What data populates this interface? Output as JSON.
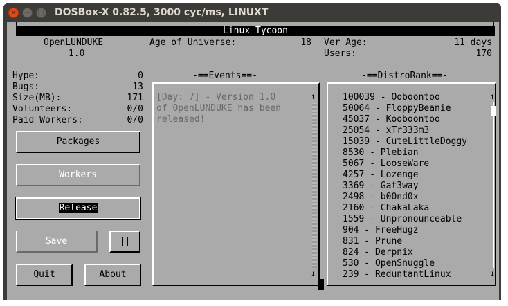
{
  "window": {
    "title": "DOSBox-X 0.82.5, 3000 cyc/ms, LINUXT"
  },
  "game": {
    "title": "Linux Tycoon",
    "distro_name": "OpenLUNDUKE",
    "distro_version": "1.0",
    "age_label": "Age of Universe:",
    "age_value": "18",
    "ver_age_label": "Ver Age:",
    "ver_age_value": "11 days",
    "users_label": "Users:",
    "users_value": "170"
  },
  "stats": [
    {
      "label": "Hype:",
      "value": "0"
    },
    {
      "label": "Bugs:",
      "value": "13"
    },
    {
      "label": "Size(MB):",
      "value": "171"
    },
    {
      "label": "Volunteers:",
      "value": "0/0"
    },
    {
      "label": "Paid Workers:",
      "value": "0/0"
    }
  ],
  "buttons": {
    "packages": "Packages",
    "workers": "Workers",
    "release": "Release",
    "save": "Save",
    "pause": "||",
    "quit": "Quit",
    "about": "About"
  },
  "events": {
    "header": "-==Events==-",
    "lines": [
      "[Day: 7] - Version 1.0",
      "of OpenLUNDUKE has been",
      "released!"
    ]
  },
  "distrorank": {
    "header": "-==DistroRank==-",
    "items": [
      "100039 - Ooboontoo",
      "50064 - FloppyBeanie",
      "45037 - Kooboontoo",
      "25054 - xTr333m3",
      "15039 - CuteLittleDoggy",
      "8530 - Plebian",
      "5067 - LooseWare",
      "4257 - Lozenge",
      "3369 - Gat3way",
      "2498 - b00nd0x",
      "2160 - ChakaLaka",
      "1559 - Unpronounceable",
      "904 - FreeHugz",
      "831 - Prune",
      "824 - Derpnix",
      "530 - OpenSnuggle",
      "239 - ReduntantLinux"
    ]
  },
  "icons": {
    "close": "×",
    "minimize": "−",
    "maximize": "□",
    "up": "↑",
    "down": "↓"
  }
}
